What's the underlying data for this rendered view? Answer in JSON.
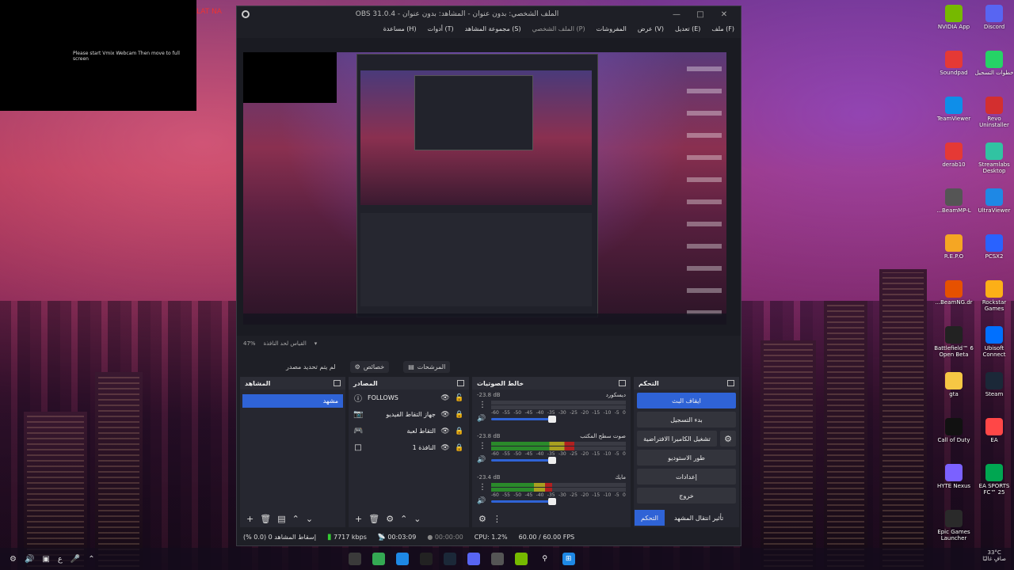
{
  "projector": {
    "message": "Please start Vmix Webcam Then move to full screen",
    "tab_label": "LAT NA"
  },
  "obs": {
    "title": "OBS 31.0.4 - الملف الشخصي: بدون عنوان - المشاهد: بدون عنوان",
    "menu": [
      "ملف (F)",
      "تعديل (E)",
      "عرض (V)",
      "المفروشات",
      "الملف الشخصي (P)",
      "مجموعة المشاهد (S)",
      "أدوات (T)",
      "مساعدة (H)"
    ],
    "zoom": "47%",
    "zoom_label": "القياس لحد النافذة",
    "no_source": "لم يتم تحديد مصدر",
    "properties_label": "خصائص",
    "filters_label": "المرشحات",
    "docks": {
      "scenes": {
        "title": "المشاهد",
        "items": [
          "مشهد"
        ]
      },
      "sources": {
        "title": "المصادر",
        "items": [
          {
            "name": "FOLLOWS",
            "icon": "text-icon"
          },
          {
            "name": "جهاز التقاط الفيديو",
            "icon": "camera-icon"
          },
          {
            "name": "التقاط لعبة",
            "icon": "gamepad-icon"
          },
          {
            "name": "النافذة 1",
            "icon": "window-icon"
          }
        ]
      },
      "mixer": {
        "title": "خالط الصوتيات",
        "channels": [
          {
            "name": "ديسكورد",
            "db": "-23.8 dB",
            "level": 0.0,
            "volume": 0.75
          },
          {
            "name": "صوت سطح المكتب",
            "db": "-23.8 dB",
            "level": 0.62,
            "volume": 0.75
          },
          {
            "name": "مايك",
            "db": "-23.4 dB",
            "level": 0.45,
            "volume": 0.75
          }
        ],
        "scale": [
          "-60",
          "-55",
          "-50",
          "-45",
          "-40",
          "-35",
          "-30",
          "-25",
          "-20",
          "-15",
          "-10",
          "-5",
          "0"
        ]
      },
      "controls": {
        "title": "التحكم",
        "stop_stream": "ايقاف البث",
        "start_recording": "بدء التسجيل",
        "virtual_camera": "تشغيل الكاميرا الافتراضية",
        "studio_mode": "طور الاستوديو",
        "settings": "إعدادات",
        "exit": "خروج"
      }
    },
    "dock_tabs": {
      "transitions": "تأثير انتقال المشهد",
      "controls": "التحكم"
    },
    "status": {
      "dropped": "إسقاط المشاهد 0 (0.0 %)",
      "bitrate": "7717 kbps",
      "stream_time": "00:03:09",
      "rec_time": "00:00:00",
      "cpu": "CPU: 1.2%",
      "fps": "60.00 / 60.00 FPS"
    }
  },
  "desktop_icons": [
    {
      "label": "NVIDIA App",
      "icon": "nvidia-icon",
      "color": "#76b900"
    },
    {
      "label": "Discord",
      "icon": "discord-icon",
      "color": "#5865f2"
    },
    {
      "label": "Soundpad",
      "icon": "soundpad-icon",
      "color": "#e53935"
    },
    {
      "label": "خطوات التسجيل",
      "icon": "whatsapp-icon",
      "color": "#25d366"
    },
    {
      "label": "TeamViewer",
      "icon": "teamviewer-icon",
      "color": "#0e8ee9"
    },
    {
      "label": "Revo Uninstaller",
      "icon": "revo-icon",
      "color": "#d32f2f"
    },
    {
      "label": "derab10",
      "icon": "derab-icon",
      "color": "#e53935"
    },
    {
      "label": "Streamlabs Desktop",
      "icon": "streamlabs-icon",
      "color": "#31c3a2"
    },
    {
      "label": "...BeamMP-L",
      "icon": "beammp-icon",
      "color": "#555555"
    },
    {
      "label": "UltraViewer",
      "icon": "ultraviewer-icon",
      "color": "#1e88e5"
    },
    {
      "label": "R.E.P.O",
      "icon": "repo-icon",
      "color": "#f5a623"
    },
    {
      "label": "PCSX2",
      "icon": "pcsx2-icon",
      "color": "#2962ff"
    },
    {
      "label": "...BeamNG.dr",
      "icon": "beamng-icon",
      "color": "#e65100"
    },
    {
      "label": "Rockstar Games",
      "icon": "rockstar-icon",
      "color": "#fcaf17"
    },
    {
      "label": "Battlefield™ 6 Open Beta",
      "icon": "battlefield-icon",
      "color": "#222222"
    },
    {
      "label": "Ubisoft Connect",
      "icon": "ubisoft-icon",
      "color": "#0070ff"
    },
    {
      "label": "gta",
      "icon": "folder-icon",
      "color": "#f6c744"
    },
    {
      "label": "Steam",
      "icon": "steam-icon",
      "color": "#1b2838"
    },
    {
      "label": "Call of Duty",
      "icon": "cod-icon",
      "color": "#111111"
    },
    {
      "label": "EA",
      "icon": "ea-icon",
      "color": "#ff4747"
    },
    {
      "label": "HYTE Nexus",
      "icon": "hyte-icon",
      "color": "#7b61ff"
    },
    {
      "label": "EA SPORTS FC™ 25",
      "icon": "fc25-icon",
      "color": "#00a651"
    },
    {
      "label": "Epic Games Launcher",
      "icon": "epic-icon",
      "color": "#2a2a2a"
    }
  ],
  "taskbar": {
    "lang": "ع",
    "temp": "33°C",
    "weather": "صافٍ غالبًا",
    "apps": [
      {
        "icon": "obs-taskbar-icon",
        "color": "#3a3a3a"
      },
      {
        "icon": "chrome-icon",
        "color": "#34a853"
      },
      {
        "icon": "edge-icon",
        "color": "#1e88e5"
      },
      {
        "icon": "obs-icon",
        "color": "#222222"
      },
      {
        "icon": "steam-taskbar-icon",
        "color": "#1b2838"
      },
      {
        "icon": "discord-taskbar-icon",
        "color": "#5865f2"
      },
      {
        "icon": "explorer-icon",
        "color": "#555555"
      },
      {
        "icon": "nvidia-taskbar-icon",
        "color": "#76b900"
      },
      {
        "icon": "search-icon",
        "color": "transparent"
      },
      {
        "icon": "windows-start-icon",
        "color": "#1e88e5"
      }
    ]
  }
}
